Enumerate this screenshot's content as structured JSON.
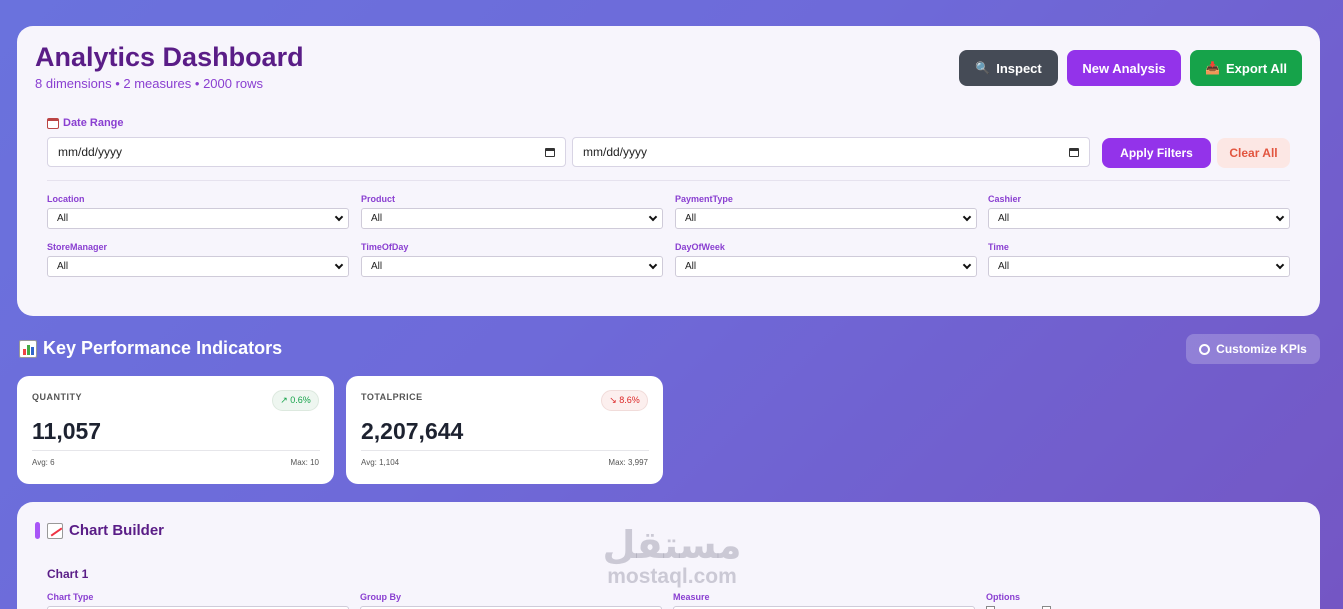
{
  "header": {
    "title": "Analytics Dashboard",
    "subtitle": "8 dimensions • 2 measures • 2000 rows",
    "inspect_label": "Inspect",
    "new_analysis_label": "New Analysis",
    "export_label": "Export All"
  },
  "filters": {
    "date_range_label": "Date Range",
    "date_start_placeholder": "mm/dd/yyyy",
    "date_end_placeholder": "mm/dd/yyyy",
    "apply_label": "Apply Filters",
    "clear_label": "Clear All",
    "dropdowns": [
      {
        "label": "Location",
        "value": "All"
      },
      {
        "label": "Product",
        "value": "All"
      },
      {
        "label": "PaymentType",
        "value": "All"
      },
      {
        "label": "Cashier",
        "value": "All"
      },
      {
        "label": "StoreManager",
        "value": "All"
      },
      {
        "label": "TimeOfDay",
        "value": "All"
      },
      {
        "label": "DayOfWeek",
        "value": "All"
      },
      {
        "label": "Time",
        "value": "All"
      }
    ]
  },
  "kpis": {
    "heading": "Key Performance Indicators",
    "customize_label": "Customize KPIs",
    "cards": [
      {
        "label": "QUANTITY",
        "value": "11,057",
        "change": "↗ 0.6%",
        "trend": "up",
        "avg": "Avg: 6",
        "max": "Max: 10"
      },
      {
        "label": "TOTALPRICE",
        "value": "2,207,644",
        "change": "↘ 8.6%",
        "trend": "down",
        "avg": "Avg: 1,104",
        "max": "Max: 3,997"
      }
    ]
  },
  "builder": {
    "title": "Chart Builder",
    "chart_name": "Chart 1",
    "fields": [
      {
        "label": "Chart Type"
      },
      {
        "label": "Group By"
      },
      {
        "label": "Measure"
      },
      {
        "label": "Options"
      }
    ]
  },
  "watermark": {
    "arabic": "مستقل",
    "latin": "mostaql.com"
  },
  "colors": {
    "accent": "#9333ea",
    "title": "#5a1d87",
    "export": "#16a34a",
    "inspect": "#454b56",
    "positive": "#16a34a",
    "negative": "#dc2626"
  }
}
